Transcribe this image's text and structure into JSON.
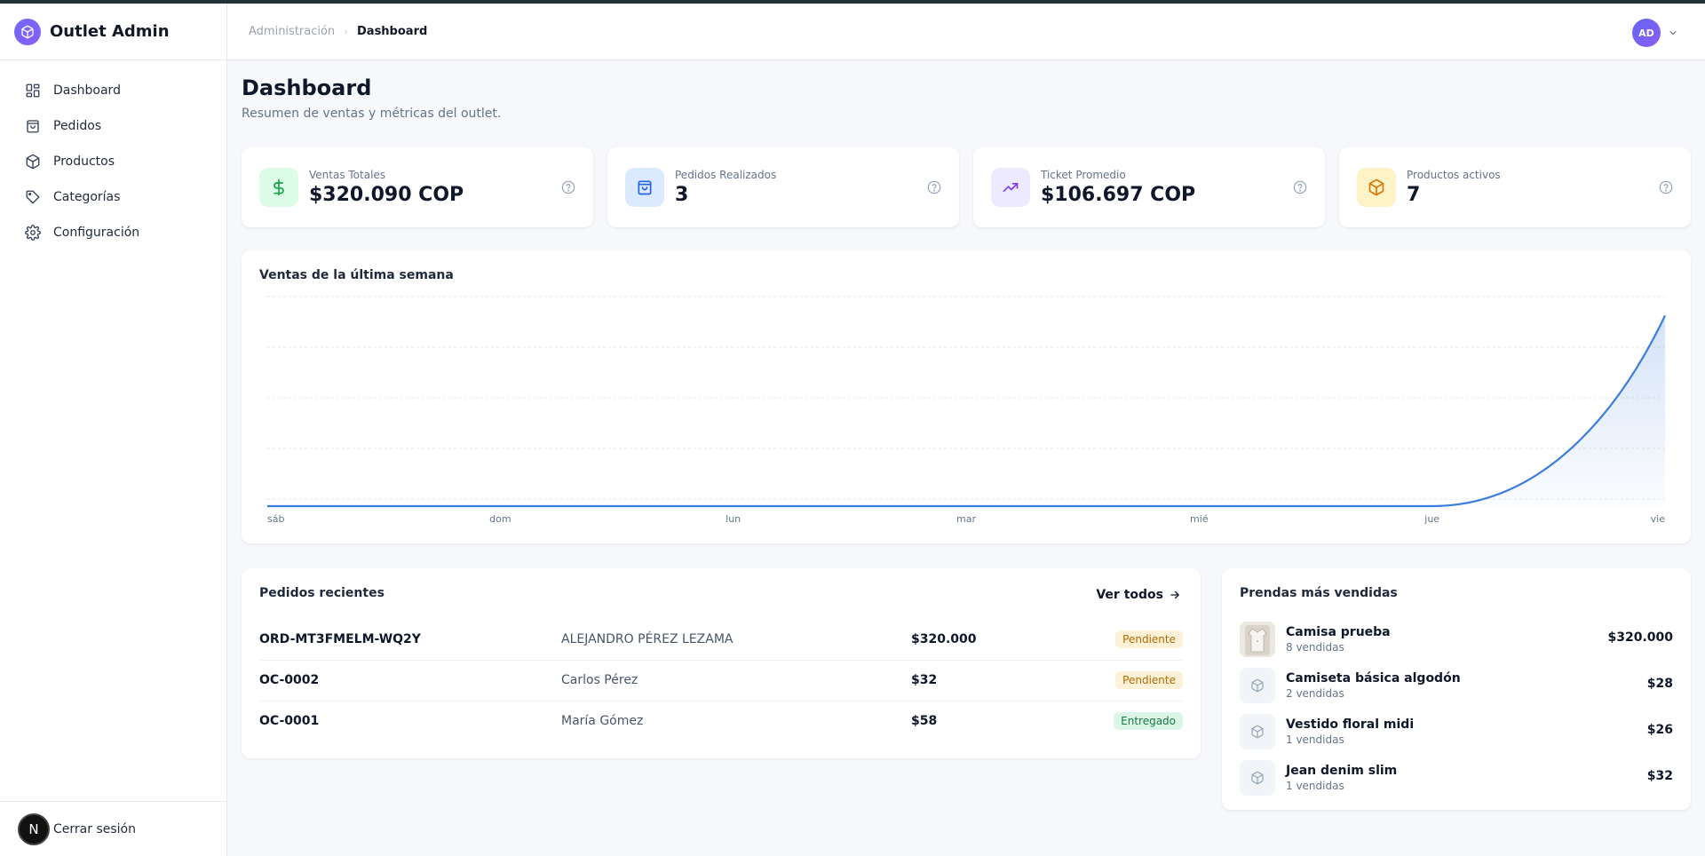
{
  "app": {
    "name": "Outlet Admin"
  },
  "sidebar": {
    "items": [
      {
        "label": "Dashboard",
        "icon": "grid-icon"
      },
      {
        "label": "Pedidos",
        "icon": "shopping-bag-icon"
      },
      {
        "label": "Productos",
        "icon": "package-icon"
      },
      {
        "label": "Categorías",
        "icon": "tag-icon"
      },
      {
        "label": "Configuración",
        "icon": "gear-icon"
      }
    ],
    "logout_label": "Cerrar sesión",
    "logout_avatar": "N"
  },
  "header": {
    "breadcrumb": [
      "Administración",
      "Dashboard"
    ],
    "user_initials": "AD"
  },
  "page": {
    "title": "Dashboard",
    "subtitle": "Resumen de ventas y métricas del outlet."
  },
  "stats": [
    {
      "label": "Ventas Totales",
      "value": "$320.090 COP",
      "icon": "dollar-icon",
      "color": "#16a34a",
      "bg": "#dcfce7"
    },
    {
      "label": "Pedidos Realizados",
      "value": "3",
      "icon": "shopping-bag-icon",
      "color": "#2563eb",
      "bg": "#dbeafe"
    },
    {
      "label": "Ticket Promedio",
      "value": "$106.697 COP",
      "icon": "trending-up-icon",
      "color": "#7c3aed",
      "bg": "#ede9fe"
    },
    {
      "label": "Productos activos",
      "value": "7",
      "icon": "package-icon",
      "color": "#d97706",
      "bg": "#fef3c7"
    }
  ],
  "chart": {
    "title": "Ventas de la última semana"
  },
  "chart_data": {
    "type": "area",
    "x": [
      "sáb",
      "dom",
      "lun",
      "mar",
      "mié",
      "jue",
      "vie"
    ],
    "series": [
      {
        "values": [
          0,
          0,
          0,
          0,
          0,
          0,
          320090
        ]
      }
    ],
    "ylim": [
      0,
      340000
    ],
    "grid": true,
    "color": "#3b7ddd"
  },
  "orders": {
    "title": "Pedidos recientes",
    "view_all": "Ver todos",
    "rows": [
      {
        "id": "ORD-MT3FMELM-WQ2Y",
        "customer": "ALEJANDRO PÉREZ LEZAMA",
        "total": "$320.000",
        "status": "Pendiente",
        "status_kind": "pending"
      },
      {
        "id": "OC-0002",
        "customer": "Carlos Pérez",
        "total": "$32",
        "status": "Pendiente",
        "status_kind": "pending"
      },
      {
        "id": "OC-0001",
        "customer": "María Gómez",
        "total": "$58",
        "status": "Entregado",
        "status_kind": "delivered"
      }
    ]
  },
  "top_products": {
    "title": "Prendas más vendidas",
    "items": [
      {
        "name": "Camisa prueba",
        "sold": "8 vendidas",
        "price": "$320.000",
        "thumb": "photo"
      },
      {
        "name": "Camiseta básica algodón",
        "sold": "2 vendidas",
        "price": "$28",
        "thumb": "package-icon"
      },
      {
        "name": "Vestido floral midi",
        "sold": "1 vendidas",
        "price": "$26",
        "thumb": "package-icon"
      },
      {
        "name": "Jean denim slim",
        "sold": "1 vendidas",
        "price": "$32",
        "thumb": "package-icon"
      }
    ]
  }
}
